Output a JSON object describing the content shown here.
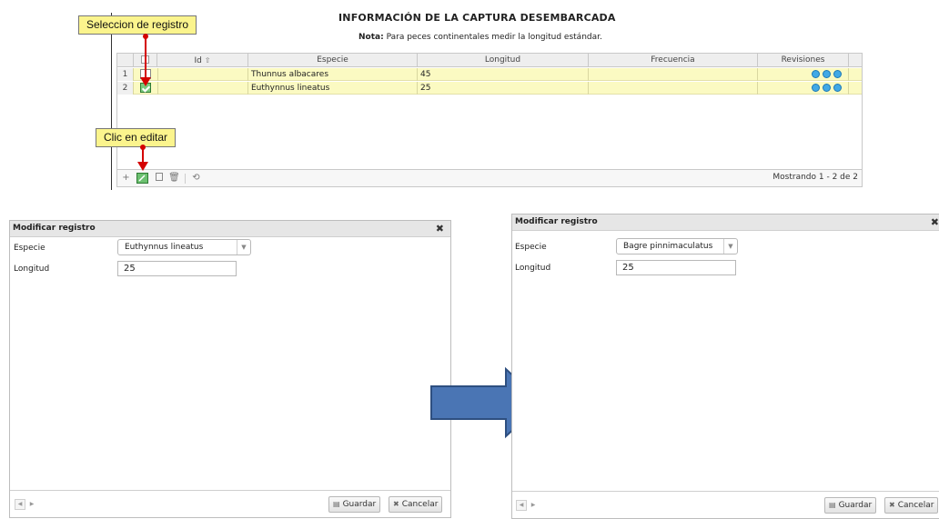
{
  "page": {
    "title": "INFORMACIÓN DE LA CAPTURA DESEMBARCADA",
    "note_label": "Nota:",
    "note_text": "Para peces continentales medir la longitud estándar."
  },
  "callouts": {
    "select_record": "Seleccion de registro",
    "click_edit": "Clic en editar"
  },
  "grid": {
    "columns": [
      "Id",
      "Especie",
      "Longitud",
      "Frecuencia",
      "Revisiones"
    ],
    "sort_icon": "sort-up-icon",
    "rows": [
      {
        "num": "1",
        "id": "",
        "especie": "Thunnus albacares",
        "longitud": "45",
        "frecuencia": "",
        "selected": false
      },
      {
        "num": "2",
        "id": "",
        "especie": "Euthynnus lineatus",
        "longitud": "25",
        "frecuencia": "",
        "selected": true
      }
    ],
    "footer": {
      "add_icon": "+",
      "delete_icon": "🗑",
      "refresh_icon": "⟲",
      "showing": "Mostrando 1 - 2 de 2"
    }
  },
  "dialogs": [
    {
      "title": "Modificar registro",
      "close_icon": "✖",
      "species_label": "Especie",
      "species_value": "Euthynnus lineatus",
      "length_label": "Longitud",
      "length_value": "25",
      "save_label": "Guardar",
      "cancel_label": "Cancelar"
    },
    {
      "title": "Modificar registro",
      "close_icon": "✖",
      "species_label": "Especie",
      "species_value": "Bagre pinnimaculatus",
      "length_label": "Longitud",
      "length_value": "25",
      "save_label": "Guardar",
      "cancel_label": "Cancelar"
    }
  ],
  "colors": {
    "row_highlight": "#fbfac2",
    "callout": "#fbf48d",
    "arrow_fill": "#4a75b4",
    "annotation": "#d40000"
  }
}
